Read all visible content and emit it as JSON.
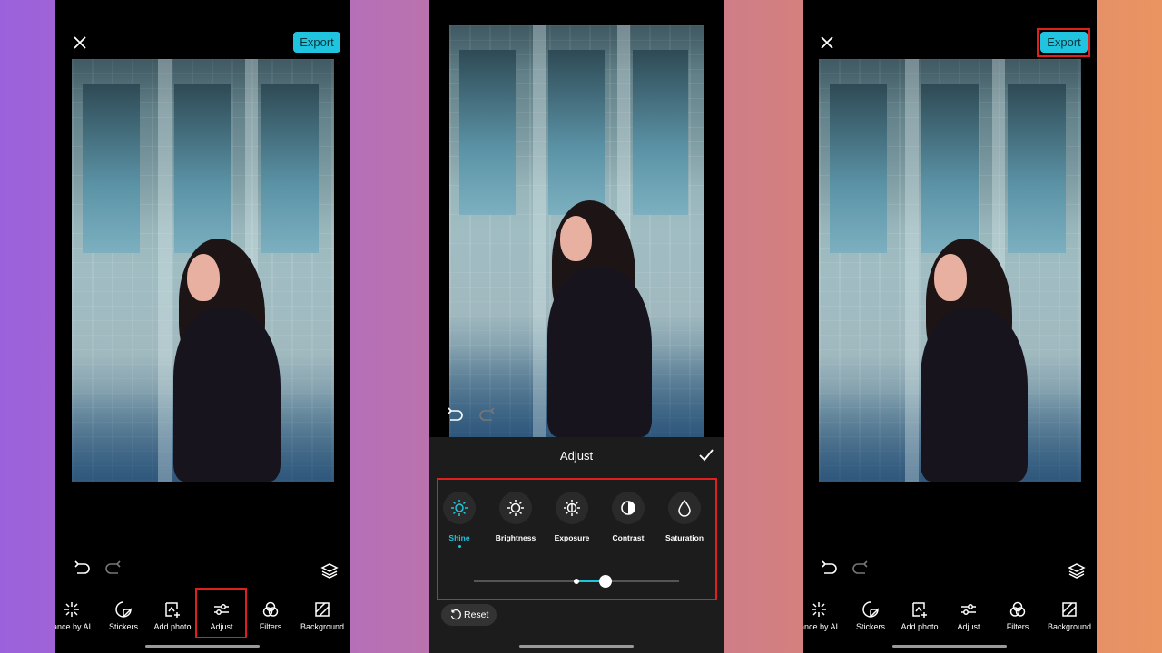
{
  "left_screen": {
    "export_label": "Export",
    "toolbar": [
      {
        "label": "ance by AI",
        "icon": "sparkle-icon"
      },
      {
        "label": "Stickers",
        "icon": "sticker-icon"
      },
      {
        "label": "Add photo",
        "icon": "add-photo-icon"
      },
      {
        "label": "Adjust",
        "icon": "sliders-icon"
      },
      {
        "label": "Filters",
        "icon": "filters-icon"
      },
      {
        "label": "Background",
        "icon": "background-icon"
      }
    ],
    "highlighted": "Adjust"
  },
  "middle_screen": {
    "panel_title": "Adjust",
    "tools": [
      {
        "label": "Shine",
        "icon": "sun-icon",
        "active": true
      },
      {
        "label": "Brightness",
        "icon": "brightness-icon",
        "active": false
      },
      {
        "label": "Exposure",
        "icon": "exposure-icon",
        "active": false
      },
      {
        "label": "Contrast",
        "icon": "contrast-icon",
        "active": false
      },
      {
        "label": "Saturation",
        "icon": "drop-icon",
        "active": false
      }
    ],
    "slider_value": 0.64,
    "reset_label": "Reset"
  },
  "right_screen": {
    "export_label": "Export",
    "toolbar": [
      {
        "label": "ance by AI",
        "icon": "sparkle-icon"
      },
      {
        "label": "Stickers",
        "icon": "sticker-icon"
      },
      {
        "label": "Add photo",
        "icon": "add-photo-icon"
      },
      {
        "label": "Adjust",
        "icon": "sliders-icon"
      },
      {
        "label": "Filters",
        "icon": "filters-icon"
      },
      {
        "label": "Background",
        "icon": "background-icon"
      }
    ],
    "highlighted": "Export"
  },
  "colors": {
    "accent": "#20c4de",
    "highlight": "#e0201f"
  }
}
